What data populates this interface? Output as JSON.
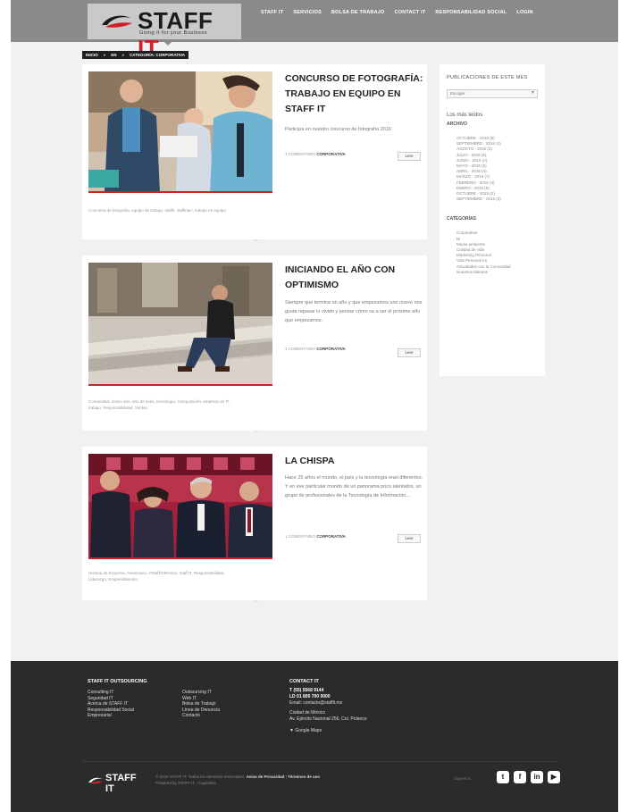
{
  "header": {
    "logo": {
      "brand_a": "STAFF",
      "brand_b": "IT",
      "tagline": "Going it for your Business"
    },
    "nav": [
      "STAFF IT",
      "SERVICIOS",
      "BOLSA DE TRABAJO",
      "CONTACT IT",
      "RESPONSABILIDAD SOCIAL",
      "LOGIN"
    ]
  },
  "breadcrumb": [
    "INICIO",
    "»",
    "EN",
    "»",
    "CATEGORÍA: CORPORATIVA"
  ],
  "posts": [
    {
      "title": "CONCURSO DE FOTOGRAFÍA: TRABAJO EN EQUIPO EN STAFF IT",
      "excerpt": "Participa en nuestro concurso de fotografía 2016",
      "meta_label": "1 COMENTARIO",
      "meta_value": "CORPORATIVA",
      "more": "Leer",
      "tags": "Concurso de fotografía, equipo de trabajo, staffit, staffintec, trabajo en equipo"
    },
    {
      "title": "INICIANDO EL AÑO CON OPTIMISMO",
      "excerpt": "Siempre que termina un año y que empezamos uno nuevo nos gusta repasar lo vivido y pensar cómo va a ser el próximo año que empezamos.",
      "meta_label": "1 COMENTARIO",
      "meta_value": "CORPORATIVA",
      "more": "Leer",
      "tags": "Comunidad, nuevo año, año de éxito, tecnología, Computación, empresa de TI, trabajo, Responsabilidad, Ventas"
    },
    {
      "title": "LA CHISPA",
      "excerpt": "Hace 25 años el mundo, el país y la tecnología eran diferentes. Y en ese particular mundo de un panorama poco alentador, un grupo de profesionales de la Tecnología de Información...",
      "meta_label": "1 COMENTARIO",
      "meta_value": "CORPORATIVA",
      "more": "Leer",
      "tags": "Historia de Empresa, Aniversario, #StaffIT25Años, Staff IT, Responsabilidad, Liderazgo, Emprendimiento"
    }
  ],
  "sidebar": {
    "title": "PUBLICACIONES DE ESTE MES",
    "select_value": "Escoger",
    "popular": "Los más leídos",
    "archive_title": "ARCHIVO",
    "archive": [
      "OCTUBRE - 2016 (5)",
      "SEPTIEMBRE - 2016 (4)",
      "AGOSTO - 2016 (3)",
      "JULIO - 2016 (6)",
      "JUNIO - 2016 (2)",
      "MAYO - 2016 (5)",
      "ABRIL - 2016 (4)",
      "MARZO - 2016 (7)",
      "FEBRERO - 2016 (3)",
      "ENERO - 2016 (5)",
      "OCTUBRE - 2015 (2)",
      "SEPTIEMBRE - 2015 (3)"
    ],
    "categories_title": "CATEGORÍAS",
    "categories": [
      "Corporativa",
      "BI",
      "Medio ambiente",
      "Calidad de vida",
      "Marketing Personal",
      "Vida Personal en",
      "Actividades con la Comunidad",
      "Nuestros talentos"
    ]
  },
  "footer": {
    "col1_title": "STAFF IT OUTSOURCING",
    "col1": [
      "Consulting IT",
      "Seguridad IT",
      "Acerca de STAFF IT",
      "Responsabilidad Social",
      "Empresarial"
    ],
    "col2": [
      "Outsourcing IT",
      "Web IT",
      "Bolsa de Trabajo",
      "Línea de Denuncia",
      "Contacto"
    ],
    "contact_title": "CONTACT IT",
    "phone1": "T (55) 5568 9144",
    "phone2": "LD 01 800 700 0000",
    "email": "Email: contacto@staffit.mx",
    "city": "Ciudad de México",
    "address": "Av. Ejército Nacional 256, Col. Polanco",
    "map_link": "Google Maps",
    "footer_brand": "STAFF IT",
    "copyright": "© 2016 STAFF IT. Todos los derechos reservados.",
    "privacy": "Aviso de Privacidad",
    "terms": "Términos de uso",
    "powered": "Powered by STAFF IT - Capicetec",
    "social_label": "Síguenos",
    "social": [
      "twitter-icon",
      "facebook-icon",
      "linkedin-icon",
      "youtube-icon"
    ]
  }
}
